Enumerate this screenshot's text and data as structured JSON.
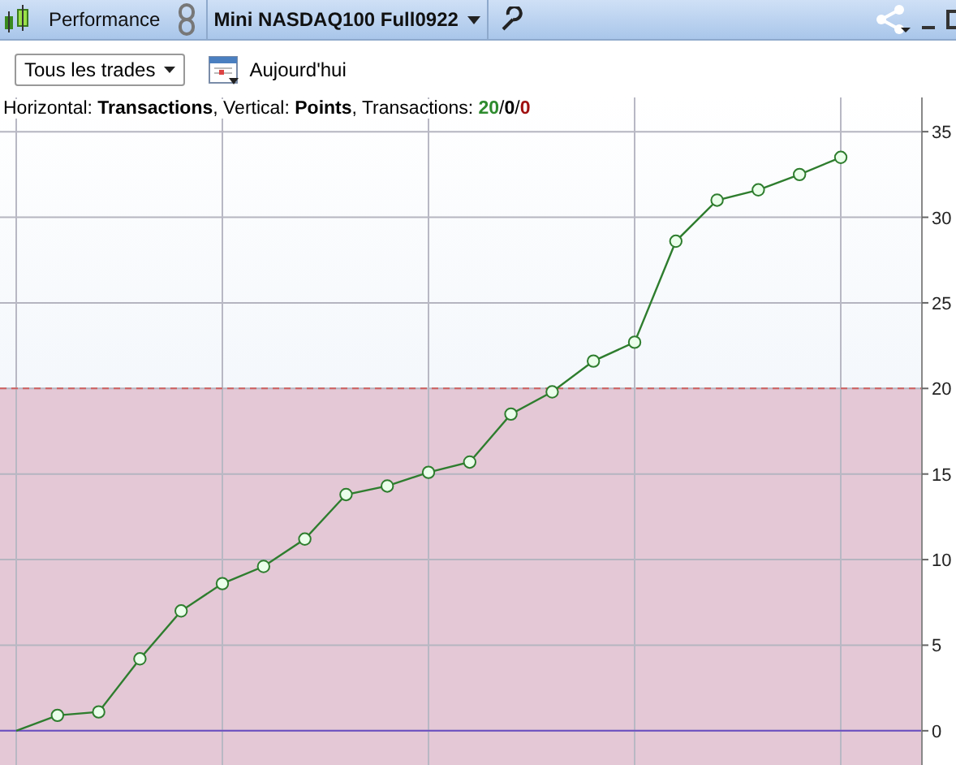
{
  "toolbar": {
    "tabs": [
      {
        "label": "Performance",
        "kind": "text"
      },
      {
        "label": "Mini NASDAQ100 Full0922",
        "kind": "dropdown"
      }
    ]
  },
  "filters": {
    "trades_dropdown": "Tous les trades",
    "date_button": "Aujourd'hui"
  },
  "chart": {
    "caption": "Horizontal: **Transactions**, Vertical: **Points**, Transactions: ",
    "counts": [
      {
        "text": "20",
        "color": "#2e8b2e"
      },
      {
        "text": "0",
        "color": "#000000"
      },
      {
        "text": "0",
        "color": "#a01010"
      }
    ],
    "separator": "/",
    "chart_data": {
      "type": "line",
      "grid": true,
      "series": [
        {
          "color": "#2e7d2e",
          "marker": "o",
          "values": [
            0,
            0.9,
            1.1,
            4.2,
            7.0,
            8.6,
            9.6,
            11.2,
            13.8,
            14.3,
            15.1,
            15.7,
            18.5,
            19.8,
            21.6,
            22.7,
            28.6,
            31.0,
            31.6,
            32.5,
            33.5
          ]
        }
      ],
      "ylim": [
        -2,
        37
      ],
      "yticks": [
        0,
        5,
        10,
        15,
        20,
        25,
        30,
        35
      ],
      "ref_lines": [
        {
          "axis": "y",
          "value": 0,
          "color": "#6a4cc0"
        },
        {
          "axis": "y",
          "value": 20,
          "color": "#d06060"
        }
      ],
      "bands": [
        {
          "axis": "y",
          "from": -2,
          "to": 20,
          "color": "#e4c8d6"
        }
      ]
    }
  }
}
